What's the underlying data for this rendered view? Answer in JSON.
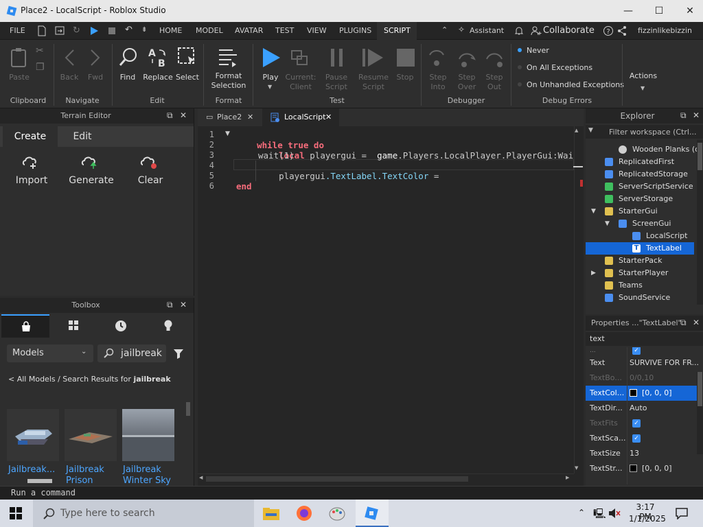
{
  "window": {
    "title": "Place2 - LocalScript - Roblox Studio",
    "minimize": "—",
    "maximize": "☐",
    "close": "✕"
  },
  "menubar": {
    "file": "FILE",
    "tabs": [
      "HOME",
      "MODEL",
      "AVATAR",
      "TEST",
      "VIEW",
      "PLUGINS",
      "SCRIPT"
    ],
    "active_tab": "SCRIPT",
    "assistant": "Assistant",
    "collaborate": "Collaborate",
    "username": "fizzinlikebizzin"
  },
  "ribbon": {
    "clipboard": {
      "paste": "Paste",
      "group": "Clipboard"
    },
    "navigate": {
      "back": "Back",
      "fwd": "Fwd",
      "group": "Navigate"
    },
    "edit": {
      "find": "Find",
      "replace": "Replace",
      "select": "Select",
      "group": "Edit"
    },
    "format": {
      "format_selection_1": "Format",
      "format_selection_2": "Selection",
      "group": "Format"
    },
    "test": {
      "play": "Play",
      "current_1": "Current:",
      "current_2": "Client",
      "pause_1": "Pause",
      "pause_2": "Script",
      "resume_1": "Resume",
      "resume_2": "Script",
      "stop": "Stop",
      "group": "Test"
    },
    "debugger": {
      "step_into_1": "Step",
      "step_into_2": "Into",
      "step_over_1": "Step",
      "step_over_2": "Over",
      "step_out_1": "Step",
      "step_out_2": "Out",
      "group": "Debugger"
    },
    "debug_errors": {
      "never": "Never",
      "on_all": "On All Exceptions",
      "on_unhandled": "On Unhandled Exceptions",
      "group": "Debug Errors"
    },
    "actions": "Actions"
  },
  "terrain": {
    "title": "Terrain Editor",
    "tabs": [
      "Create",
      "Edit"
    ],
    "tools": [
      "Import",
      "Generate",
      "Clear"
    ]
  },
  "toolbox": {
    "title": "Toolbox",
    "category": "Models",
    "search_value": "jailbreak",
    "breadcrumb_prefix": "< All Models / Search Results for ",
    "breadcrumb_query": "jailbreak",
    "items": [
      {
        "name_1": "Jailbreak...",
        "name_2": ""
      },
      {
        "name_1": "Jailbreak",
        "name_2": "Prison"
      },
      {
        "name_1": "Jailbreak",
        "name_2": "Winter Sky"
      }
    ]
  },
  "editor": {
    "tabs": [
      "Place2",
      "LocalScript"
    ],
    "active_tab": "LocalScript",
    "line_numbers": [
      "1",
      "2",
      "3",
      "4",
      "5",
      "6"
    ],
    "code": {
      "l1_kw": "while",
      "l1_true": "true",
      "l1_do": "do",
      "l2_local": "local",
      "l2_var": "playergui",
      "l2_eq": " = ",
      "l2_game": "game",
      "l2_rest": ".Players.LocalPlayer.PlayerGui:Wai",
      "l3": "wait(1)",
      "l4_a": "playergui",
      "l4_b": ".TextLabel.TextColor",
      "l4_eq": " =",
      "l6": "end"
    }
  },
  "explorer": {
    "title": "Explorer",
    "filter_placeholder": "Filter workspace (Ctrl...",
    "rows": [
      {
        "label": "Wooden Planks (o",
        "indent": 3,
        "color": "#cfcfcf"
      },
      {
        "label": "ReplicatedFirst",
        "indent": 1,
        "color": "#4b8ef0"
      },
      {
        "label": "ReplicatedStorage",
        "indent": 1,
        "color": "#4b8ef0"
      },
      {
        "label": "ServerScriptService",
        "indent": 1,
        "color": "#3fbf5f"
      },
      {
        "label": "ServerStorage",
        "indent": 1,
        "color": "#3fbf5f"
      },
      {
        "label": "StarterGui",
        "indent": 1,
        "color": "#e0c050"
      },
      {
        "label": "ScreenGui",
        "indent": 2,
        "color": "#4b8ef0"
      },
      {
        "label": "LocalScript",
        "indent": 3,
        "color": "#4b8ef0"
      },
      {
        "label": "TextLabel",
        "indent": 3,
        "color": "#4b8ef0"
      },
      {
        "label": "StarterPack",
        "indent": 1,
        "color": "#e0c050"
      },
      {
        "label": "StarterPlayer",
        "indent": 1,
        "color": "#e0c050"
      },
      {
        "label": "Teams",
        "indent": 1,
        "color": "#e0c050"
      },
      {
        "label": "SoundService",
        "indent": 1,
        "color": "#4b8ef0"
      }
    ],
    "selected": "TextLabel"
  },
  "properties": {
    "title": "Properties ...\"TextLabel\"",
    "filter_value": "text",
    "rows": [
      {
        "name": "Text",
        "value": "SURVIVE FOR FR..."
      },
      {
        "name": "TextBo...",
        "value": "0/0,10",
        "dim": true
      },
      {
        "name": "TextCol...",
        "value": "[0, 0, 0]",
        "swatch": "#000000",
        "sel": true
      },
      {
        "name": "TextDir...",
        "value": "Auto"
      },
      {
        "name": "TextFits",
        "check": true,
        "dim": true
      },
      {
        "name": "TextSca...",
        "check": true
      },
      {
        "name": "TextSize",
        "value": "13"
      },
      {
        "name": "TextStr...",
        "value": "[0, 0, 0]",
        "swatch": "#000000"
      }
    ]
  },
  "command_bar": {
    "placeholder": "Run a command"
  },
  "taskbar": {
    "search_placeholder": "Type here to search",
    "time": "3:17 PM",
    "date": "1/1/2025"
  },
  "colors": {
    "accent": "#1566d6",
    "keyword": "#f86d7c",
    "builtin": "#84d6f7",
    "text": "#cccccc"
  }
}
